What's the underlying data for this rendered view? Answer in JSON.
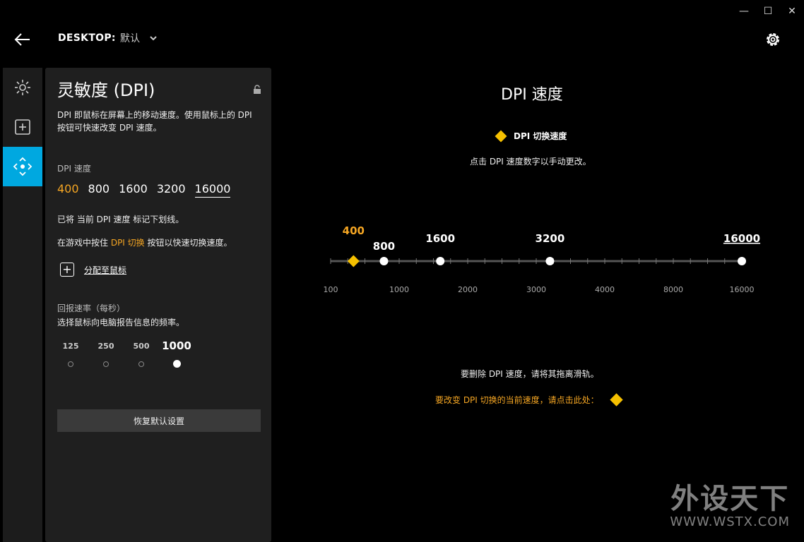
{
  "window": {
    "minimize": "—",
    "maximize": "☐",
    "close": "✕"
  },
  "header": {
    "profile_label": "DESKTOP:",
    "profile_name": "默认"
  },
  "panel": {
    "title": "灵敏度 (DPI)",
    "description": "DPI 即鼠标在屏幕上的移动速度。使用鼠标上的 DPI 按钮可快速改变 DPI 速度。",
    "dpi_label": "DPI 速度",
    "dpi_values": [
      "400",
      "800",
      "1600",
      "3200",
      "16000"
    ],
    "underline_note": "已将 当前 DPI 速度 标记下划线。",
    "shift_note_pre": "在游戏中按住 ",
    "shift_note_hl": "DPI 切换",
    "shift_note_post": " 按钮以快速切换速度。",
    "assign_label": "分配至鼠标",
    "report_label": "回报速率（每秒）",
    "report_desc": "选择鼠标向电脑报告信息的频率。",
    "report_rates": [
      "125",
      "250",
      "500",
      "1000"
    ],
    "report_selected": "1000",
    "reset_label": "恢复默认设置"
  },
  "main": {
    "title": "DPI 速度",
    "shift_label": "DPI 切换速度",
    "hint_click": "点击 DPI 速度数字以手动更改。",
    "hint_remove": "要删除 DPI 速度，请将其拖离滑轨。",
    "hint_change_shift": "要改变 DPI 切换的当前速度，请点击此处："
  },
  "chart_data": {
    "type": "slider",
    "axis_ticks": [
      "100",
      "1000",
      "2000",
      "3000",
      "4000",
      "8000",
      "16000"
    ],
    "points": [
      {
        "value": 400,
        "label": "400",
        "kind": "shift"
      },
      {
        "value": 800,
        "label": "800",
        "kind": "dpi"
      },
      {
        "value": 1600,
        "label": "1600",
        "kind": "dpi"
      },
      {
        "value": 3200,
        "label": "3200",
        "kind": "dpi"
      },
      {
        "value": 16000,
        "label": "16000",
        "kind": "dpi",
        "current": true
      }
    ],
    "colors": {
      "shift": "#f5c000",
      "accent": "#00a8e0",
      "highlight": "#f5a623"
    }
  },
  "watermark": {
    "big": "外设天下",
    "small": "WWW.WSTX.COM"
  }
}
